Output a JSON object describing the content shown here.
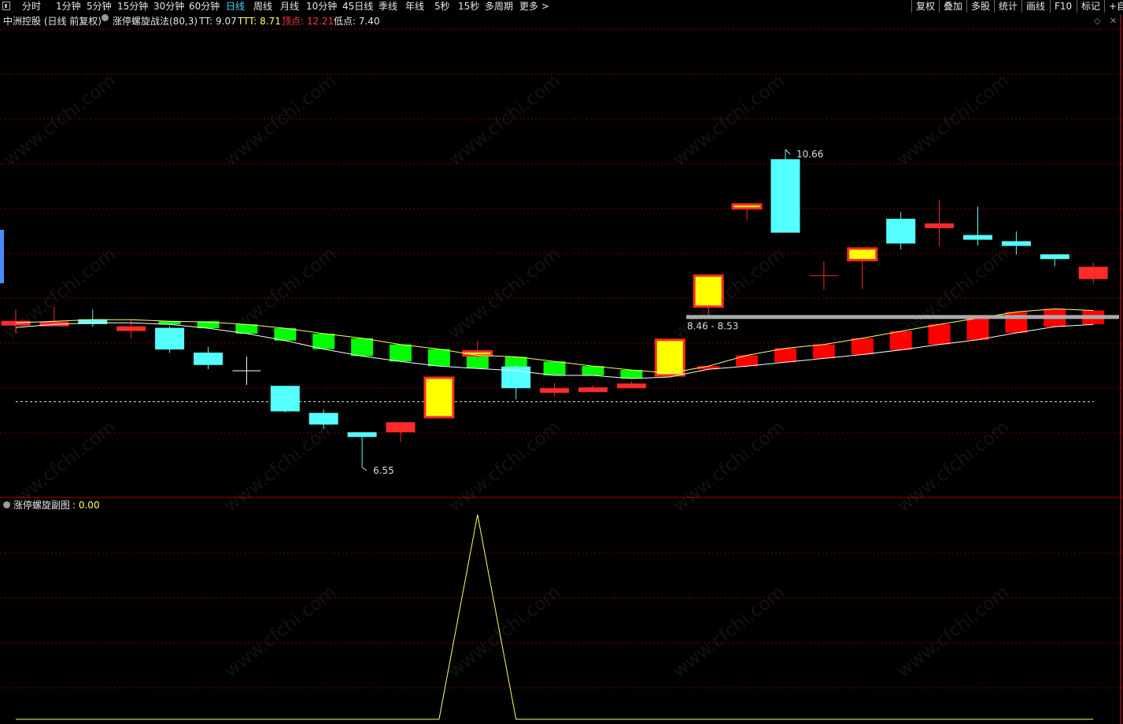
{
  "toolbar": {
    "periods": [
      "分时",
      "1分钟",
      "5分钟",
      "15分钟",
      "30分钟",
      "60分钟",
      "日线",
      "周线",
      "月线",
      "10分钟",
      "45日线",
      "季线",
      "年线",
      "5秒",
      "15秒",
      "多周期",
      "更多 >"
    ],
    "active_period": "日线",
    "right_buttons": [
      "复权",
      "叠加",
      "多股",
      "统计",
      "画线",
      "F10",
      "标记",
      "+自选"
    ]
  },
  "main_chart": {
    "stock_title": "中洲控股 (日线 前复权)",
    "indicator_name": "涨停螺旋战法(80,3)",
    "tt_label": "TT: 9.07",
    "ttt_label": "TTT: 8.71",
    "top_label": "顶点: 12.21",
    "low_label": "低点: 7.40",
    "max_annotation": "10.66",
    "min_annotation": "6.55",
    "range_annotation": "8.46 - 8.53"
  },
  "sub_chart": {
    "indicator_name": "涨停螺旋副图",
    "value_label": ": 0.00"
  },
  "watermark": "www.cfchi.com",
  "colors": {
    "up": "#ff2a2a",
    "down": "#54ffff",
    "limit_up": "#ffff00",
    "green_band": "#00ff00",
    "red_band": "#ff0000",
    "ma_line": "#ffff66",
    "grid": "#7a0000",
    "active_tab": "#3bd9ff",
    "label_red": "#ff3b3b"
  },
  "chart_data": {
    "type": "candlestick",
    "price_min": 6.55,
    "price_max": 10.66,
    "candles": [
      {
        "o": 8.44,
        "h": 8.59,
        "l": 8.28,
        "c": 8.44,
        "kind": "up"
      },
      {
        "o": 8.43,
        "h": 8.63,
        "l": 8.38,
        "c": 8.43,
        "kind": "up"
      },
      {
        "o": 8.46,
        "h": 8.59,
        "l": 8.37,
        "c": 8.44,
        "kind": "down"
      },
      {
        "o": 8.37,
        "h": 8.47,
        "l": 8.22,
        "c": 8.32,
        "kind": "up"
      },
      {
        "o": 8.35,
        "h": 8.38,
        "l": 8.03,
        "c": 8.08,
        "kind": "down"
      },
      {
        "o": 8.03,
        "h": 8.11,
        "l": 7.82,
        "c": 7.88,
        "kind": "down"
      },
      {
        "o": 7.8,
        "h": 7.8,
        "l": 7.8,
        "c": 7.8,
        "kind": "doji"
      },
      {
        "o": 7.6,
        "h": 7.6,
        "l": 7.26,
        "c": 7.28,
        "kind": "down"
      },
      {
        "o": 7.25,
        "h": 7.3,
        "l": 7.05,
        "c": 7.11,
        "kind": "down"
      },
      {
        "o": 7.0,
        "h": 7.0,
        "l": 6.55,
        "c": 6.98,
        "kind": "down"
      },
      {
        "o": 7.01,
        "h": 7.11,
        "l": 6.88,
        "c": 7.13,
        "kind": "up"
      },
      {
        "o": 7.2,
        "h": 7.71,
        "l": 7.18,
        "c": 7.71,
        "kind": "limit"
      },
      {
        "o": 8.05,
        "h": 8.19,
        "l": 7.95,
        "c": 8.05,
        "kind": "limit"
      },
      {
        "o": 7.85,
        "h": 7.87,
        "l": 7.43,
        "c": 7.58,
        "kind": "down"
      },
      {
        "o": 7.56,
        "h": 7.64,
        "l": 7.47,
        "c": 7.57,
        "kind": "up"
      },
      {
        "o": 7.58,
        "h": 7.61,
        "l": 7.53,
        "c": 7.58,
        "kind": "up"
      },
      {
        "o": 7.63,
        "h": 7.66,
        "l": 7.59,
        "c": 7.62,
        "kind": "up"
      },
      {
        "o": 7.74,
        "h": 8.21,
        "l": 7.72,
        "c": 8.2,
        "kind": "limit"
      },
      {
        "o": 8.63,
        "h": 9.02,
        "l": 8.47,
        "c": 9.03,
        "kind": "limit"
      },
      {
        "o": 9.95,
        "h": 9.95,
        "l": 9.75,
        "c": 9.95,
        "kind": "limit"
      },
      {
        "o": 10.53,
        "h": 10.66,
        "l": 9.59,
        "c": 9.59,
        "kind": "down"
      },
      {
        "o": 9.03,
        "h": 9.03,
        "l": 9.03,
        "c": 9.03,
        "kind": "doji"
      },
      {
        "o": 9.23,
        "h": 9.38,
        "l": 8.86,
        "c": 9.38,
        "kind": "limit"
      },
      {
        "o": 9.76,
        "h": 9.85,
        "l": 9.37,
        "c": 9.45,
        "kind": "down"
      },
      {
        "o": 9.7,
        "h": 10.01,
        "l": 9.41,
        "c": 9.7,
        "kind": "up"
      },
      {
        "o": 9.55,
        "h": 9.92,
        "l": 9.42,
        "c": 9.55,
        "kind": "down"
      },
      {
        "o": 9.47,
        "h": 9.6,
        "l": 9.3,
        "c": 9.47,
        "kind": "down"
      },
      {
        "o": 9.3,
        "h": 9.3,
        "l": 9.15,
        "c": 9.3,
        "kind": "down"
      },
      {
        "o": 9.14,
        "h": 9.2,
        "l": 8.93,
        "c": 8.99,
        "kind": "up"
      }
    ],
    "bands": [
      {
        "idx": 4,
        "top": 8.44,
        "bot": 8.4,
        "color": "green"
      },
      {
        "idx": 5,
        "top": 8.44,
        "bot": 8.35,
        "color": "green"
      },
      {
        "idx": 6,
        "top": 8.4,
        "bot": 8.28,
        "color": "green"
      },
      {
        "idx": 7,
        "top": 8.35,
        "bot": 8.19,
        "color": "green"
      },
      {
        "idx": 8,
        "top": 8.28,
        "bot": 8.08,
        "color": "green"
      },
      {
        "idx": 9,
        "top": 8.22,
        "bot": 7.99,
        "color": "green"
      },
      {
        "idx": 10,
        "top": 8.14,
        "bot": 7.92,
        "color": "green"
      },
      {
        "idx": 11,
        "top": 8.08,
        "bot": 7.86,
        "color": "green"
      },
      {
        "idx": 12,
        "top": 8.0,
        "bot": 7.83,
        "color": "green"
      },
      {
        "idx": 13,
        "top": 7.98,
        "bot": 7.8,
        "color": "green"
      },
      {
        "idx": 14,
        "top": 7.92,
        "bot": 7.74,
        "color": "green"
      },
      {
        "idx": 15,
        "top": 7.86,
        "bot": 7.74,
        "color": "green"
      },
      {
        "idx": 16,
        "top": 7.81,
        "bot": 7.7,
        "color": "green"
      },
      {
        "idx": 18,
        "top": 7.86,
        "bot": 7.82,
        "color": "red"
      },
      {
        "idx": 19,
        "top": 8.0,
        "bot": 7.86,
        "color": "red"
      },
      {
        "idx": 20,
        "top": 8.09,
        "bot": 7.91,
        "color": "red"
      },
      {
        "idx": 21,
        "top": 8.14,
        "bot": 7.96,
        "color": "red"
      },
      {
        "idx": 22,
        "top": 8.22,
        "bot": 8.01,
        "color": "red"
      },
      {
        "idx": 23,
        "top": 8.31,
        "bot": 8.07,
        "color": "red"
      },
      {
        "idx": 24,
        "top": 8.4,
        "bot": 8.14,
        "color": "red"
      },
      {
        "idx": 25,
        "top": 8.48,
        "bot": 8.2,
        "color": "red"
      },
      {
        "idx": 26,
        "top": 8.56,
        "bot": 8.29,
        "color": "red"
      },
      {
        "idx": 27,
        "top": 8.6,
        "bot": 8.37,
        "color": "red"
      },
      {
        "idx": 28,
        "top": 8.58,
        "bot": 8.4,
        "color": "red"
      }
    ],
    "ma_upper": [
      8.42,
      8.44,
      8.46,
      8.46,
      8.44,
      8.43,
      8.4,
      8.35,
      8.28,
      8.22,
      8.14,
      8.08,
      8.0,
      7.98,
      7.92,
      7.86,
      7.81,
      7.77,
      7.86,
      8.0,
      8.09,
      8.14,
      8.22,
      8.31,
      8.4,
      8.48,
      8.56,
      8.6,
      8.58
    ],
    "ma_lower": [
      8.36,
      8.4,
      8.42,
      8.42,
      8.4,
      8.35,
      8.28,
      8.19,
      8.08,
      7.99,
      7.92,
      7.86,
      7.83,
      7.8,
      7.74,
      7.74,
      7.7,
      7.72,
      7.82,
      7.86,
      7.91,
      7.96,
      8.01,
      8.07,
      8.14,
      8.2,
      8.29,
      8.37,
      8.4
    ],
    "dashed_level": 7.4,
    "range_line": 8.5,
    "sub_values": [
      0,
      0,
      0,
      0,
      0,
      0,
      0,
      0,
      0,
      0,
      0,
      0,
      1,
      0,
      0,
      0,
      0,
      0,
      0,
      0,
      0,
      0,
      0,
      0,
      0,
      0,
      0,
      0,
      0
    ],
    "sub_max": 1
  }
}
